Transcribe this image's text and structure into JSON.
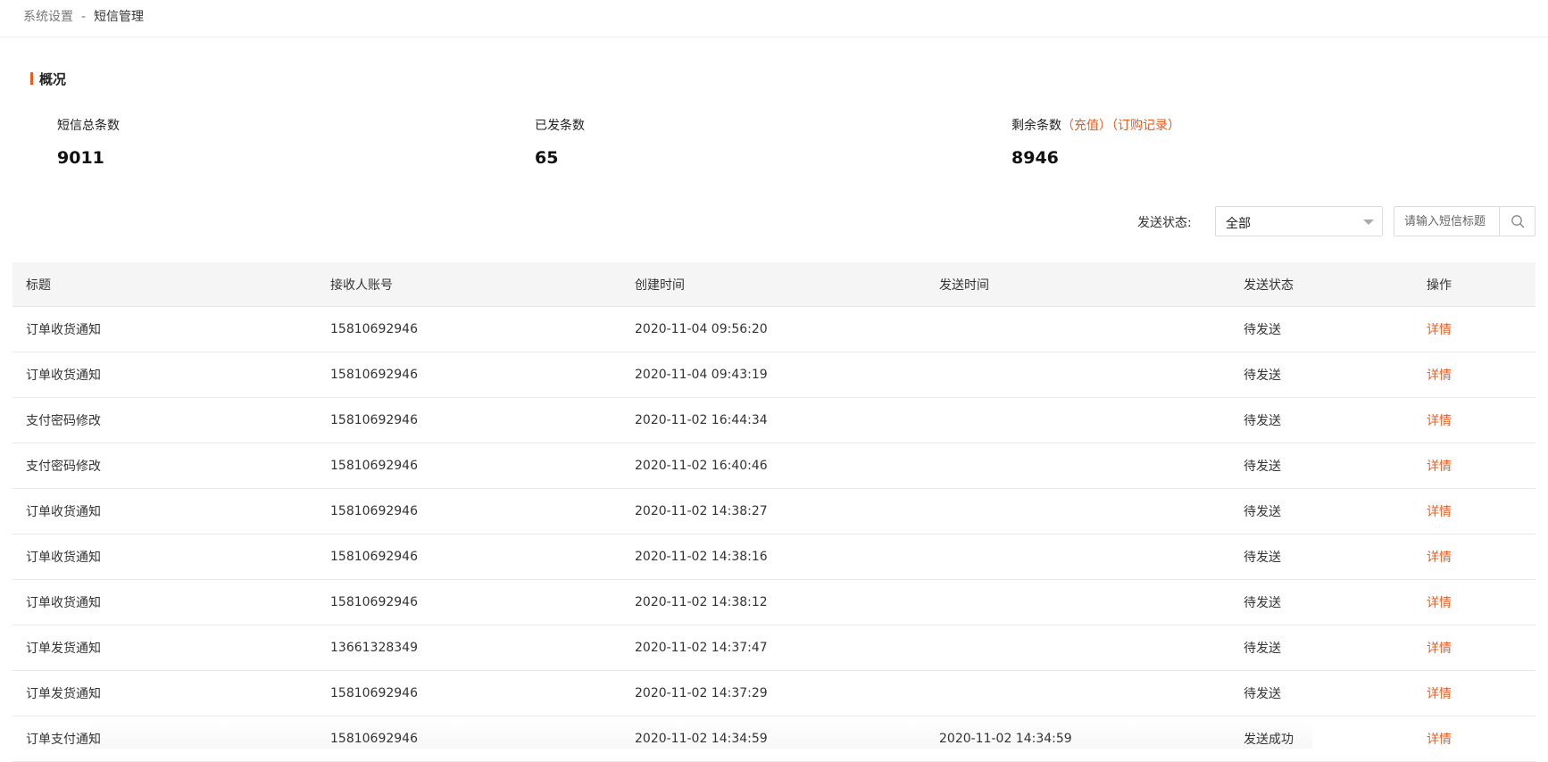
{
  "breadcrumb": {
    "parent": "系统设置",
    "separator": "-",
    "current": "短信管理"
  },
  "overview": {
    "title": "概况",
    "stats": {
      "total": {
        "label": "短信总条数",
        "value": "9011"
      },
      "sent": {
        "label": "已发条数",
        "value": "65"
      },
      "remaining": {
        "label": "剩余条数",
        "value": "8946",
        "recharge_link": "（充值）",
        "order_link": "（订购记录）"
      }
    }
  },
  "filter": {
    "status_label": "发送状态:",
    "status_value": "全部",
    "search_placeholder": "请输入短信标题"
  },
  "table": {
    "columns": [
      "标题",
      "接收人账号",
      "创建时间",
      "发送时间",
      "发送状态",
      "操作"
    ],
    "rows": [
      {
        "title": "订单收货通知",
        "account": "15810692946",
        "created": "2020-11-04 09:56:20",
        "sent": "",
        "status": "待发送",
        "action": "详情"
      },
      {
        "title": "订单收货通知",
        "account": "15810692946",
        "created": "2020-11-04 09:43:19",
        "sent": "",
        "status": "待发送",
        "action": "详情"
      },
      {
        "title": "支付密码修改",
        "account": "15810692946",
        "created": "2020-11-02 16:44:34",
        "sent": "",
        "status": "待发送",
        "action": "详情"
      },
      {
        "title": "支付密码修改",
        "account": "15810692946",
        "created": "2020-11-02 16:40:46",
        "sent": "",
        "status": "待发送",
        "action": "详情"
      },
      {
        "title": "订单收货通知",
        "account": "15810692946",
        "created": "2020-11-02 14:38:27",
        "sent": "",
        "status": "待发送",
        "action": "详情"
      },
      {
        "title": "订单收货通知",
        "account": "15810692946",
        "created": "2020-11-02 14:38:16",
        "sent": "",
        "status": "待发送",
        "action": "详情"
      },
      {
        "title": "订单收货通知",
        "account": "15810692946",
        "created": "2020-11-02 14:38:12",
        "sent": "",
        "status": "待发送",
        "action": "详情"
      },
      {
        "title": "订单发货通知",
        "account": "13661328349",
        "created": "2020-11-02 14:37:47",
        "sent": "",
        "status": "待发送",
        "action": "详情"
      },
      {
        "title": "订单发货通知",
        "account": "15810692946",
        "created": "2020-11-02 14:37:29",
        "sent": "",
        "status": "待发送",
        "action": "详情"
      },
      {
        "title": "订单支付通知",
        "account": "15810692946",
        "created": "2020-11-02 14:34:59",
        "sent": "2020-11-02 14:34:59",
        "status": "发送成功",
        "action": "详情"
      }
    ]
  },
  "colors": {
    "accent": "#f05a1a",
    "header_bg": "#f5f5f5",
    "border": "#e8e8e8"
  },
  "icons": {
    "search": "search-icon",
    "dropdown": "chevron-down-icon"
  }
}
